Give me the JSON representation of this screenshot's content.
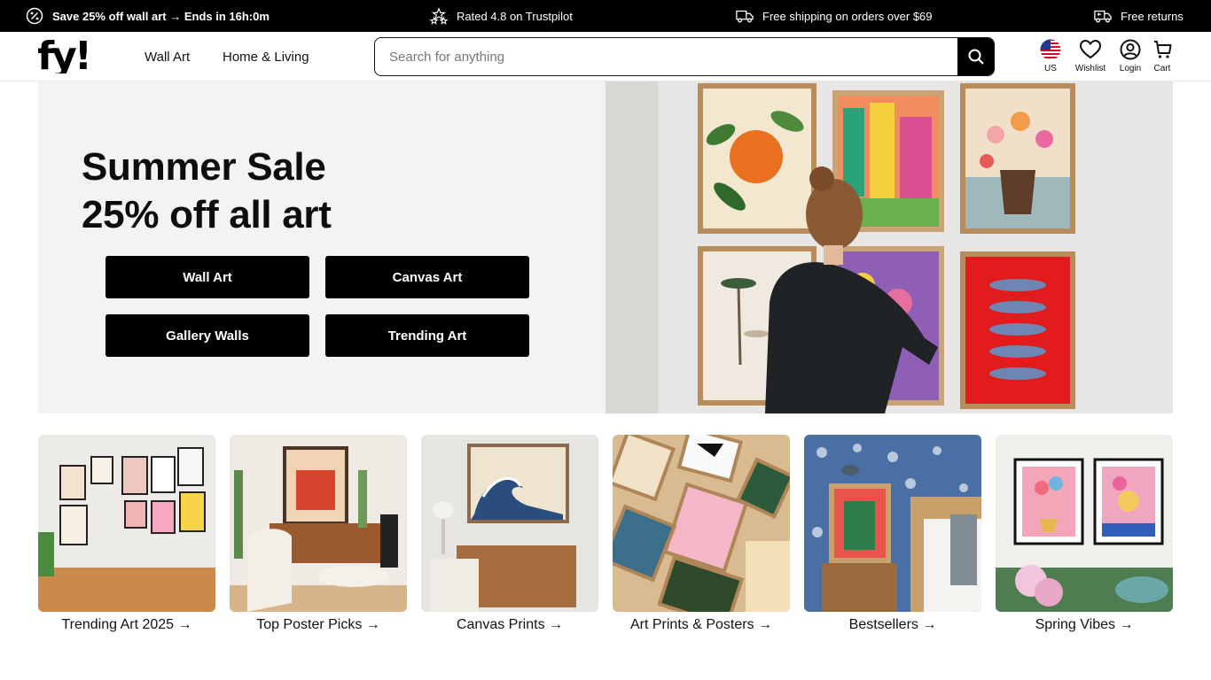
{
  "announcement": {
    "sale": "Save 25% off wall art → Ends in 16h:0m",
    "rating": "Rated 4.8 on Trustpilot",
    "shipping": "Free shipping on orders over $69",
    "returns": "Free returns"
  },
  "header": {
    "logo_text": "fy!",
    "nav": [
      "Wall Art",
      "Home & Living"
    ],
    "search_placeholder": "Search for anything",
    "search_value": "",
    "icons": {
      "region": "US",
      "wishlist": "Wishlist",
      "login": "Login",
      "cart": "Cart"
    }
  },
  "hero": {
    "title_line1": "Summer Sale",
    "title_line2": "25% off all art",
    "buttons": [
      "Wall Art",
      "Canvas Art",
      "Gallery Walls",
      "Trending Art"
    ]
  },
  "categories": [
    {
      "label": "Trending Art 2025 →"
    },
    {
      "label": "Top Poster Picks →"
    },
    {
      "label": "Canvas Prints →"
    },
    {
      "label": "Art Prints & Posters →"
    },
    {
      "label": "Bestsellers →"
    },
    {
      "label": "Spring Vibes →"
    }
  ],
  "icons": [
    "sale-badge-icon",
    "stars-icon",
    "truck-icon",
    "return-truck-icon",
    "search-icon",
    "us-flag-icon",
    "heart-icon",
    "user-icon",
    "cart-icon"
  ],
  "colors": {
    "bar": "#000000",
    "hero_bg": "#f3f3f3",
    "button": "#000000",
    "button_text": "#ffffff"
  }
}
